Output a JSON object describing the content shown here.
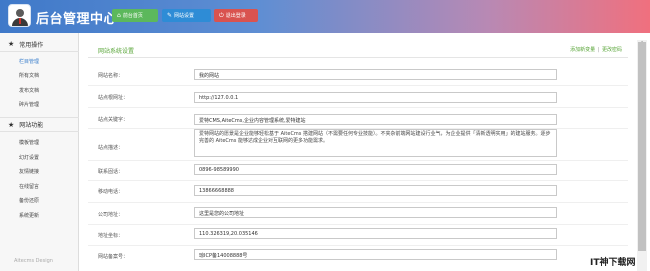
{
  "header": {
    "app_title": "后台管理中心",
    "buttons": {
      "home": "前台首页",
      "settings": "网站设置",
      "logout": "退出登录"
    },
    "colors": {
      "home": "#5cb85c",
      "settings": "#2e8cd6",
      "logout": "#d9534f"
    }
  },
  "sidebar": {
    "groups": [
      {
        "title": "常用操作",
        "items": [
          "栏目管理",
          "所有文档",
          "发布文档",
          "碎片管理"
        ],
        "active": "栏目管理"
      },
      {
        "title": "网站功能",
        "items": [
          "模板管理",
          "幻灯设置",
          "友情链接",
          "在线留言",
          "备份还原",
          "系统更新"
        ]
      }
    ],
    "footer": "Aitecms Design"
  },
  "main": {
    "title": "网站系统设置",
    "links": {
      "add": "添加新变量",
      "separator": "|",
      "update": "更改密码"
    },
    "fields": [
      {
        "label": "网站名称：",
        "value": "我的网站"
      },
      {
        "label": "站点根网址：",
        "value": "http://127.0.0.1"
      },
      {
        "label": "站点关键字：",
        "value": "爱特CMS,AiteCms,企业内容管理系统,爱特建站"
      },
      {
        "label": "站点描述：",
        "value": "爱特网站的愿景是企业能够轻松基于 AiteCms 搭建网站（不需要任何专业技能）。不夹杂前端网站建设行业气，为企业提供「清新透明实用」的建站服务。逐步完善的 AiteCms 能够达成企业对互联网的更多功能需求。"
      },
      {
        "label": "联系固话：",
        "value": "0896-98589990"
      },
      {
        "label": "移动电话：",
        "value": "13866668888"
      },
      {
        "label": "公司地址：",
        "value": "这里是您的公司地址"
      },
      {
        "label": "地址坐标：",
        "value": "110.326319,20.035146"
      },
      {
        "label": "网站备案号：",
        "value": "琼ICP备14008888号"
      }
    ]
  },
  "watermark": "IT神下载网"
}
